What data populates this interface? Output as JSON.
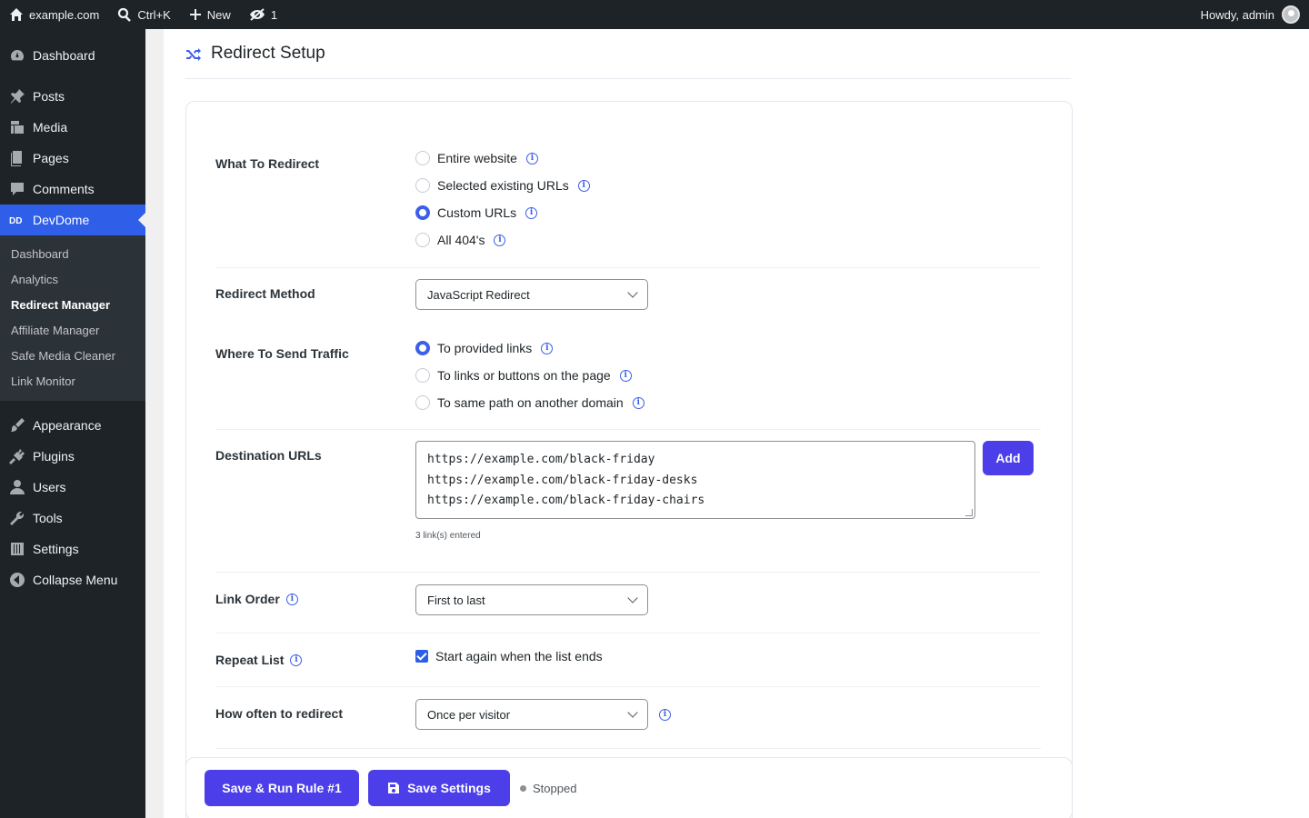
{
  "adminbar": {
    "site": "example.com",
    "search_shortcut": "Ctrl+K",
    "new_label": "New",
    "hidden_count": "1",
    "greeting": "Howdy, admin"
  },
  "sidebar": {
    "top": [
      {
        "label": "Dashboard",
        "icon": "dashboard-icon"
      },
      {
        "label": "Posts",
        "icon": "pin-icon"
      },
      {
        "label": "Media",
        "icon": "media-icon"
      },
      {
        "label": "Pages",
        "icon": "pages-icon"
      },
      {
        "label": "Comments",
        "icon": "comment-icon"
      },
      {
        "label": "DevDome",
        "icon": "devdome-icon"
      }
    ],
    "submenu": [
      "Dashboard",
      "Analytics",
      "Redirect Manager",
      "Affiliate Manager",
      "Safe Media Cleaner",
      "Link Monitor"
    ],
    "bottom": [
      {
        "label": "Appearance",
        "icon": "brush-icon"
      },
      {
        "label": "Plugins",
        "icon": "plug-icon"
      },
      {
        "label": "Users",
        "icon": "user-icon"
      },
      {
        "label": "Tools",
        "icon": "wrench-icon"
      },
      {
        "label": "Settings",
        "icon": "sliders-icon"
      },
      {
        "label": "Collapse Menu",
        "icon": "collapse-icon"
      }
    ]
  },
  "page": {
    "title": "Redirect Setup"
  },
  "form": {
    "what": {
      "label": "What To Redirect",
      "options": [
        "Entire website",
        "Selected existing URLs",
        "Custom URLs",
        "All 404's"
      ],
      "selected": "Custom URLs"
    },
    "method": {
      "label": "Redirect Method",
      "value": "JavaScript Redirect"
    },
    "where": {
      "label": "Where To Send Traffic",
      "options": [
        "To provided links",
        "To links or buttons on the page",
        "To same path on another domain"
      ],
      "selected": "To provided links"
    },
    "destinations": {
      "label": "Destination URLs",
      "urls": [
        "https://example.com/black-friday",
        "https://example.com/black-friday-desks",
        "https://example.com/black-friday-chairs"
      ],
      "add_label": "Add",
      "hint": "3 link(s) entered"
    },
    "order": {
      "label": "Link Order",
      "value": "First to last"
    },
    "repeat": {
      "label": "Repeat List",
      "checkbox_label": "Start again when the list ends",
      "checked": true
    },
    "frequency": {
      "label": "How often to redirect",
      "value": "Once per visitor"
    }
  },
  "footer": {
    "run_label": "Save & Run Rule #1",
    "save_label": "Save Settings",
    "status": "Stopped"
  },
  "colors": {
    "accent": "#3c5ee8",
    "button": "#4c3ee8",
    "sidebar_bg": "#1d2327",
    "current_menu": "#2f5ee8"
  }
}
